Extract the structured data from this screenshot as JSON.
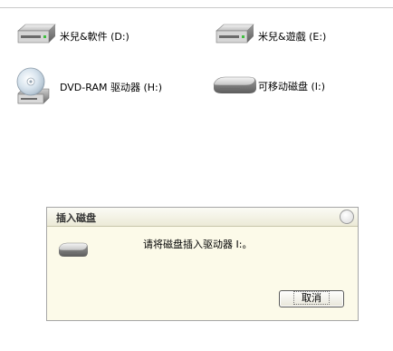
{
  "drives": [
    {
      "label": "米兒&軟件 (D:)",
      "icon": "hard-drive-icon"
    },
    {
      "label": "米兒&遊戲 (E:)",
      "icon": "hard-drive-icon"
    },
    {
      "label": "DVD-RAM 驱动器 (H:)",
      "icon": "dvd-drive-icon"
    },
    {
      "label": "可移动磁盘 (I:)",
      "icon": "removable-disk-icon"
    }
  ],
  "dialog": {
    "title": "插入磁盘",
    "message": "请将磁盘插入驱动器 I:。",
    "cancel_label": "取消",
    "icon": "removable-disk-icon",
    "close_icon": "close-icon"
  },
  "colors": {
    "dialog_background": "#fcfae9",
    "dialog_border": "#a6a6a6"
  }
}
